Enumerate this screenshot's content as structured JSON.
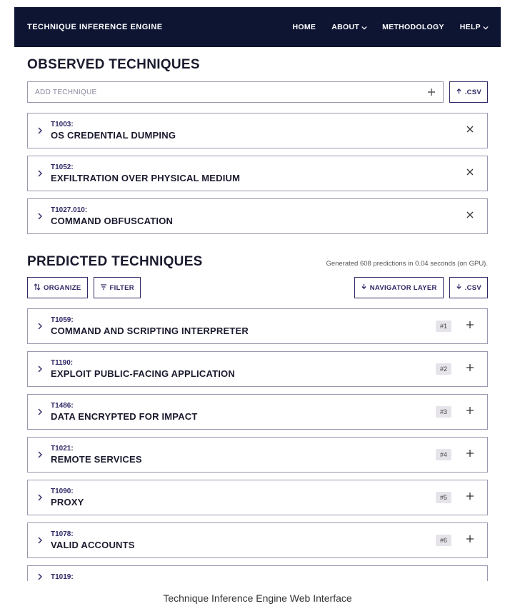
{
  "header": {
    "title": "TECHNIQUE INFERENCE ENGINE",
    "nav": {
      "home": "HOME",
      "about": "ABOUT",
      "methodology": "METHODOLOGY",
      "help": "HELP"
    }
  },
  "observed": {
    "title": "OBSERVED TECHNIQUES",
    "add_placeholder": "ADD TECHNIQUE",
    "csv_label": ".CSV",
    "items": [
      {
        "id": "T1003:",
        "name": "OS CREDENTIAL DUMPING"
      },
      {
        "id": "T1052:",
        "name": "EXFILTRATION OVER PHYSICAL MEDIUM"
      },
      {
        "id": "T1027.010:",
        "name": "COMMAND OBFUSCATION"
      }
    ]
  },
  "predicted": {
    "title": "PREDICTED TECHNIQUES",
    "note": "Generated 608 predictions in 0.04 seconds (on GPU).",
    "organize_label": "ORGANIZE",
    "filter_label": "FILTER",
    "nav_layer_label": "NAVIGATOR LAYER",
    "csv_label": ".CSV",
    "items": [
      {
        "id": "T1059:",
        "name": "COMMAND AND SCRIPTING INTERPRETER",
        "rank": "#1"
      },
      {
        "id": "T1190:",
        "name": "EXPLOIT PUBLIC-FACING APPLICATION",
        "rank": "#2"
      },
      {
        "id": "T1486:",
        "name": "DATA ENCRYPTED FOR IMPACT",
        "rank": "#3"
      },
      {
        "id": "T1021:",
        "name": "REMOTE SERVICES",
        "rank": "#4"
      },
      {
        "id": "T1090:",
        "name": "PROXY",
        "rank": "#5"
      },
      {
        "id": "T1078:",
        "name": "VALID ACCOUNTS",
        "rank": "#6"
      }
    ],
    "cutoff_id": "T1019:"
  },
  "caption": "Technique Inference Engine Web Interface"
}
